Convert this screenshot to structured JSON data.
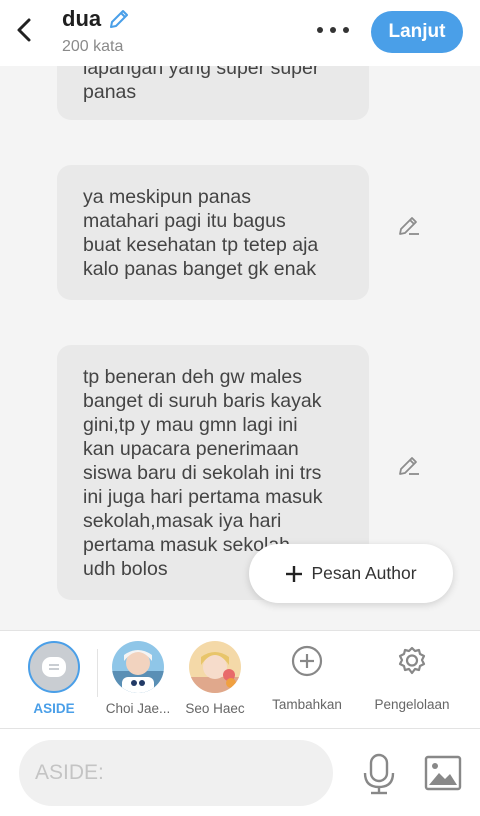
{
  "header": {
    "title": "dua",
    "subtitle": "200 kata",
    "next_label": "Lanjut"
  },
  "messages": [
    {
      "text": "lapangan yang super super\npanas"
    },
    {
      "text": "ya meskipun panas\nmatahari pagi itu bagus\nbuat kesehatan tp tetep aja\nkalo panas banget gk enak"
    },
    {
      "text": "tp beneran deh gw males\nbanget di suruh baris kayak\ngini,tp y mau gmn lagi ini\nkan upacara penerimaan\nsiswa baru di sekolah ini trs\nini juga hari pertama masuk\nsekolah,masak iya hari\npertama masuk sekolah\nudh bolos"
    }
  ],
  "author_button": {
    "label": "Pesan Author"
  },
  "characters": {
    "aside": {
      "label": "ASIDE"
    },
    "choi": {
      "label": "Choi Jae..."
    },
    "seo": {
      "label": "Seo Haec"
    },
    "add": {
      "label": "Tambahkan"
    },
    "manage": {
      "label": "Pengelolaan"
    }
  },
  "input": {
    "placeholder": "ASIDE:"
  },
  "colors": {
    "accent": "#4a9fe8",
    "bubble": "#e9e9e9",
    "background": "#f4f4f4"
  }
}
